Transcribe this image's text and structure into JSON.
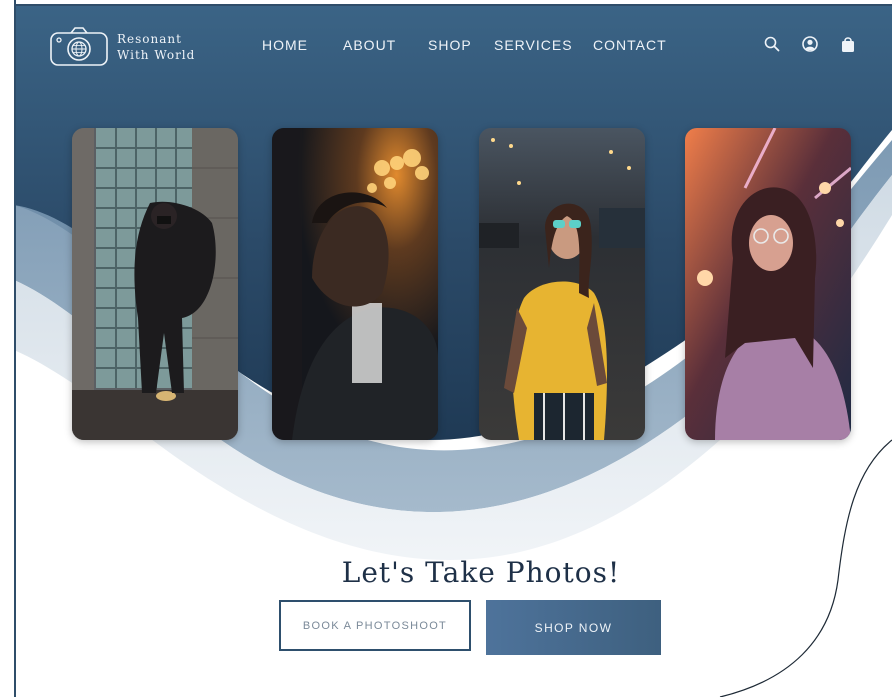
{
  "brand": {
    "line1": "Resonant",
    "line2": "With World"
  },
  "nav": {
    "items": [
      {
        "label": "HOME"
      },
      {
        "label": "ABOUT"
      },
      {
        "label": "SHOP"
      },
      {
        "label": "SERVICES"
      },
      {
        "label": "CONTACT"
      }
    ]
  },
  "header_icons": [
    "search-icon",
    "account-icon",
    "shopping-bag-icon"
  ],
  "gallery": {
    "photos": [
      {
        "subject": "woman-in-black-coat-by-glass-block-wall"
      },
      {
        "subject": "young-man-with-orange-bokeh-lights"
      },
      {
        "subject": "woman-in-yellow-tshirt-at-night"
      },
      {
        "subject": "woman-with-glasses-in-neon-lights"
      }
    ]
  },
  "hero": {
    "headline": "Let's Take Photos!",
    "book_button": "BOOK A PHOTOSHOOT",
    "shop_button": "SHOP NOW"
  },
  "colors": {
    "navy_dark": "#1e3a56",
    "navy_mid": "#36597a",
    "accent": "#4e739b",
    "text_light": "#eef3f8",
    "headline": "#1e3047"
  }
}
